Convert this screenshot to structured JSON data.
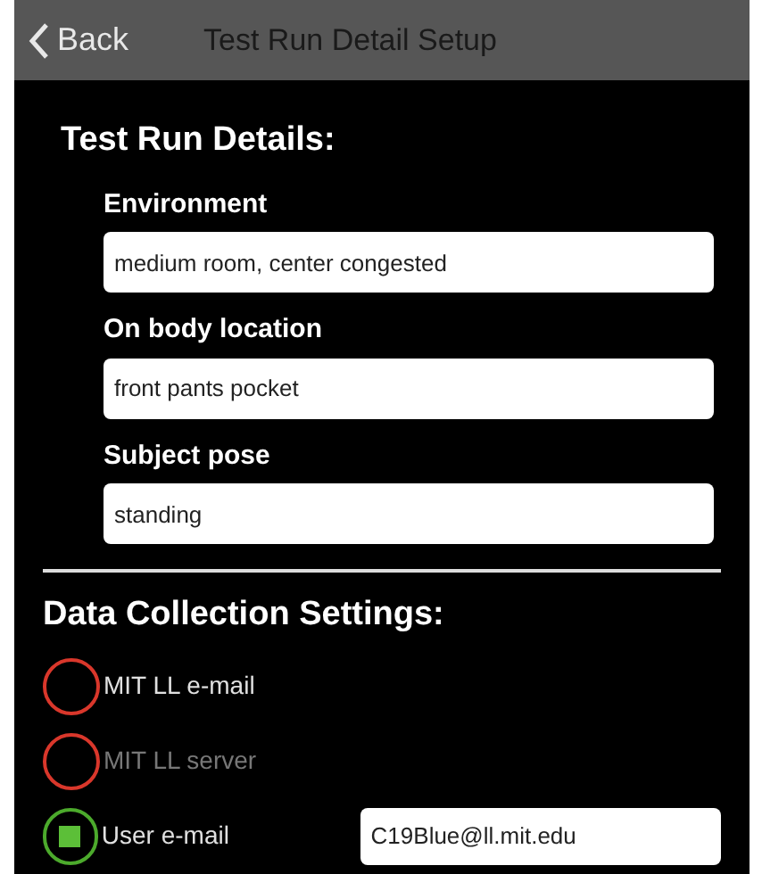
{
  "nav": {
    "back": "Back",
    "title": "Test Run Detail Setup"
  },
  "details": {
    "heading": "Test Run Details:",
    "fields": [
      {
        "label": "Environment",
        "value": "medium room, center congested"
      },
      {
        "label": "On body location",
        "value": "front pants pocket"
      },
      {
        "label": "Subject pose",
        "value": "standing"
      }
    ]
  },
  "collection": {
    "heading": "Data Collection Settings:",
    "options": [
      {
        "label": "MIT LL e-mail",
        "selected": false,
        "disabled": false
      },
      {
        "label": "MIT LL server",
        "selected": false,
        "disabled": true
      },
      {
        "label": "User e-mail",
        "selected": true,
        "disabled": false,
        "value": "C19Blue@ll.mit.edu"
      }
    ]
  }
}
